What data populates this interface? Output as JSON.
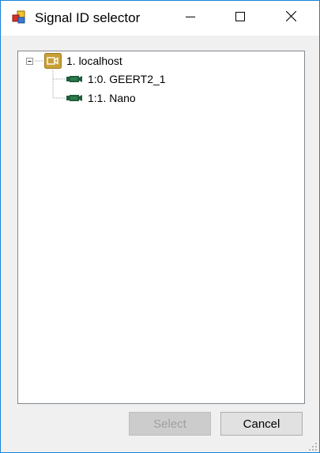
{
  "window": {
    "title": "Signal ID selector",
    "controls": {
      "minimize_icon": "minimize-icon",
      "maximize_icon": "maximize-icon",
      "close_icon": "close-icon"
    }
  },
  "tree": {
    "root": {
      "label": "1. localhost",
      "expanded": true,
      "icon": "camera-icon",
      "icon_color": "#c8a036"
    },
    "children": [
      {
        "label": "1:0. GEERT2_1",
        "icon": "video-camera-icon",
        "icon_color": "#1f5e3a"
      },
      {
        "label": "1:1. Nano",
        "icon": "video-camera-icon",
        "icon_color": "#1f5e3a"
      }
    ]
  },
  "buttons": {
    "select_label": "Select",
    "select_enabled": false,
    "cancel_label": "Cancel"
  },
  "colors": {
    "accent_border": "#1883d7",
    "dialog_bg": "#f0f0f0"
  }
}
